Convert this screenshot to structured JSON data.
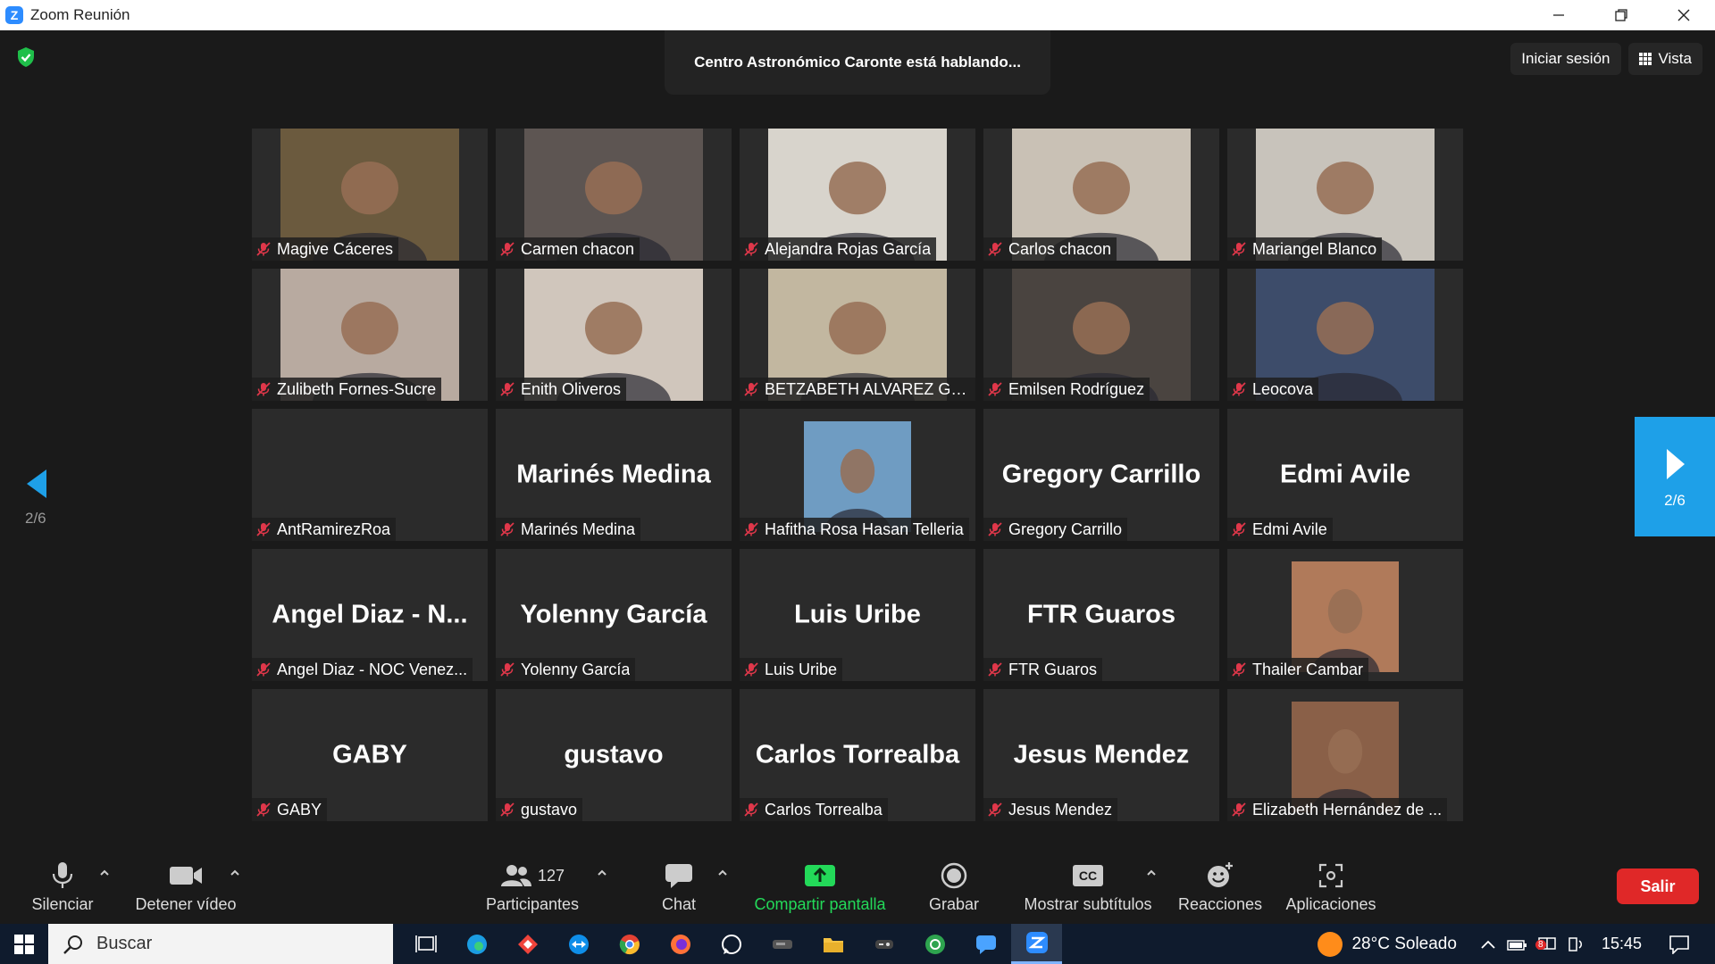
{
  "window": {
    "title": "Zoom Reunión",
    "logo_letter": "Z"
  },
  "meeting": {
    "speaking_banner": "Centro Astronómico Caronte está hablando...",
    "sign_in_label": "Iniciar sesión",
    "view_label": "Vista",
    "page_left": "2/6",
    "page_right": "2/6"
  },
  "participants": [
    {
      "name": "Magive Cáceres",
      "video": true,
      "bg": "#6b5a3e"
    },
    {
      "name": "Carmen chacon",
      "video": true,
      "bg": "#5d5552"
    },
    {
      "name": "Alejandra Rojas García",
      "video": true,
      "bg": "#d8d4cc"
    },
    {
      "name": "Carlos chacon",
      "video": true,
      "bg": "#c9c1b5"
    },
    {
      "name": "Mariangel Blanco",
      "video": true,
      "bg": "#c8c3bb"
    },
    {
      "name": "Zulibeth Fornes-Sucre",
      "video": true,
      "bg": "#b8aaa0"
    },
    {
      "name": "Enith Oliveros",
      "video": true,
      "bg": "#d0c6bc"
    },
    {
      "name": "BETZABETH ALVAREZ GA...",
      "video": true,
      "bg": "#c2b7a0"
    },
    {
      "name": "Emilsen Rodríguez",
      "video": true,
      "bg": "#4a4440"
    },
    {
      "name": "Leocova",
      "video": true,
      "bg": "#3d4c6a"
    },
    {
      "name": "AntRamirezRoa",
      "video": false,
      "big": ""
    },
    {
      "name": "Marinés Medina",
      "video": false,
      "big": "Marinés Medina"
    },
    {
      "name": "Hafitha Rosa Hasan Telleria",
      "video": true,
      "bg": "#6f9cc2"
    },
    {
      "name": "Gregory Carrillo",
      "video": false,
      "big": "Gregory Carrillo"
    },
    {
      "name": "Edmi Avile",
      "video": false,
      "big": "Edmi Avile"
    },
    {
      "name": "Angel Diaz - NOC Venez...",
      "video": false,
      "big": "Angel Diaz - N..."
    },
    {
      "name": "Yolenny García",
      "video": false,
      "big": "Yolenny García"
    },
    {
      "name": "Luis Uribe",
      "video": false,
      "big": "Luis Uribe"
    },
    {
      "name": "FTR Guaros",
      "video": false,
      "big": "FTR Guaros"
    },
    {
      "name": "Thailer Cambar",
      "video": true,
      "bg": "#b07a5a"
    },
    {
      "name": "GABY",
      "video": false,
      "big": "GABY"
    },
    {
      "name": "gustavo",
      "video": false,
      "big": "gustavo"
    },
    {
      "name": "Carlos Torrealba",
      "video": false,
      "big": "Carlos Torrealba"
    },
    {
      "name": "Jesus Mendez",
      "video": false,
      "big": "Jesus Mendez"
    },
    {
      "name": "Elizabeth Hernández de ...",
      "video": true,
      "bg": "#8a6048"
    }
  ],
  "toolbar": {
    "mute": "Silenciar",
    "video": "Detener vídeo",
    "participants": "Participantes",
    "participants_count": "127",
    "chat": "Chat",
    "share": "Compartir pantalla",
    "record": "Grabar",
    "captions": "Mostrar subtítulos",
    "cc": "CC",
    "reactions": "Reacciones",
    "apps": "Aplicaciones",
    "leave": "Salir"
  },
  "taskbar": {
    "search_placeholder": "Buscar",
    "weather": "28°C Soleado",
    "time": "15:45",
    "notification_count": "8"
  },
  "colors": {
    "accent_blue": "#1ea0e8",
    "share_green": "#23d959",
    "leave_red": "#e02828",
    "muted_red": "#e0374a"
  }
}
